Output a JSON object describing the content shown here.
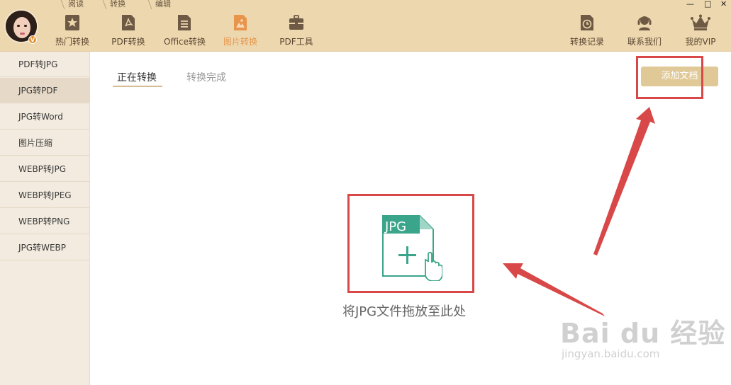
{
  "mode_tabs": [
    "阅读",
    "转换",
    "编辑"
  ],
  "nav": [
    {
      "label": "热门转换",
      "icon": "star-icon"
    },
    {
      "label": "PDF转换",
      "icon": "pdf-icon"
    },
    {
      "label": "Office转换",
      "icon": "document-icon"
    },
    {
      "label": "图片转换",
      "icon": "image-icon",
      "active": true
    },
    {
      "label": "PDF工具",
      "icon": "toolbox-icon"
    }
  ],
  "nav_right": [
    {
      "label": "转换记录",
      "icon": "clock-icon"
    },
    {
      "label": "联系我们",
      "icon": "headset-icon"
    },
    {
      "label": "我的VIP",
      "icon": "crown-icon"
    }
  ],
  "avatar_badge": "V",
  "window_controls": [
    "—",
    "□",
    "✕"
  ],
  "sidebar": [
    {
      "label": "PDF转JPG"
    },
    {
      "label": "JPG转PDF",
      "active": true
    },
    {
      "label": "JPG转Word"
    },
    {
      "label": "图片压缩"
    },
    {
      "label": "WEBP转JPG"
    },
    {
      "label": "WEBP转JPEG"
    },
    {
      "label": "WEBP转PNG"
    },
    {
      "label": "JPG转WEBP"
    }
  ],
  "content_tabs": {
    "converting": "正在转换",
    "done": "转换完成"
  },
  "add_button": "添加文档",
  "drop": {
    "file_tag": "JPG",
    "hint": "将JPG文件拖放至此处"
  },
  "watermark": {
    "main": "Bai du 经验",
    "sub": "jingyan.baidu.com"
  },
  "colors": {
    "header": "#ecd7ae",
    "accent": "#e8954b",
    "add_button": "#e0c996",
    "icon_teal": "#3aa58a",
    "annotation_red": "#d94848"
  }
}
